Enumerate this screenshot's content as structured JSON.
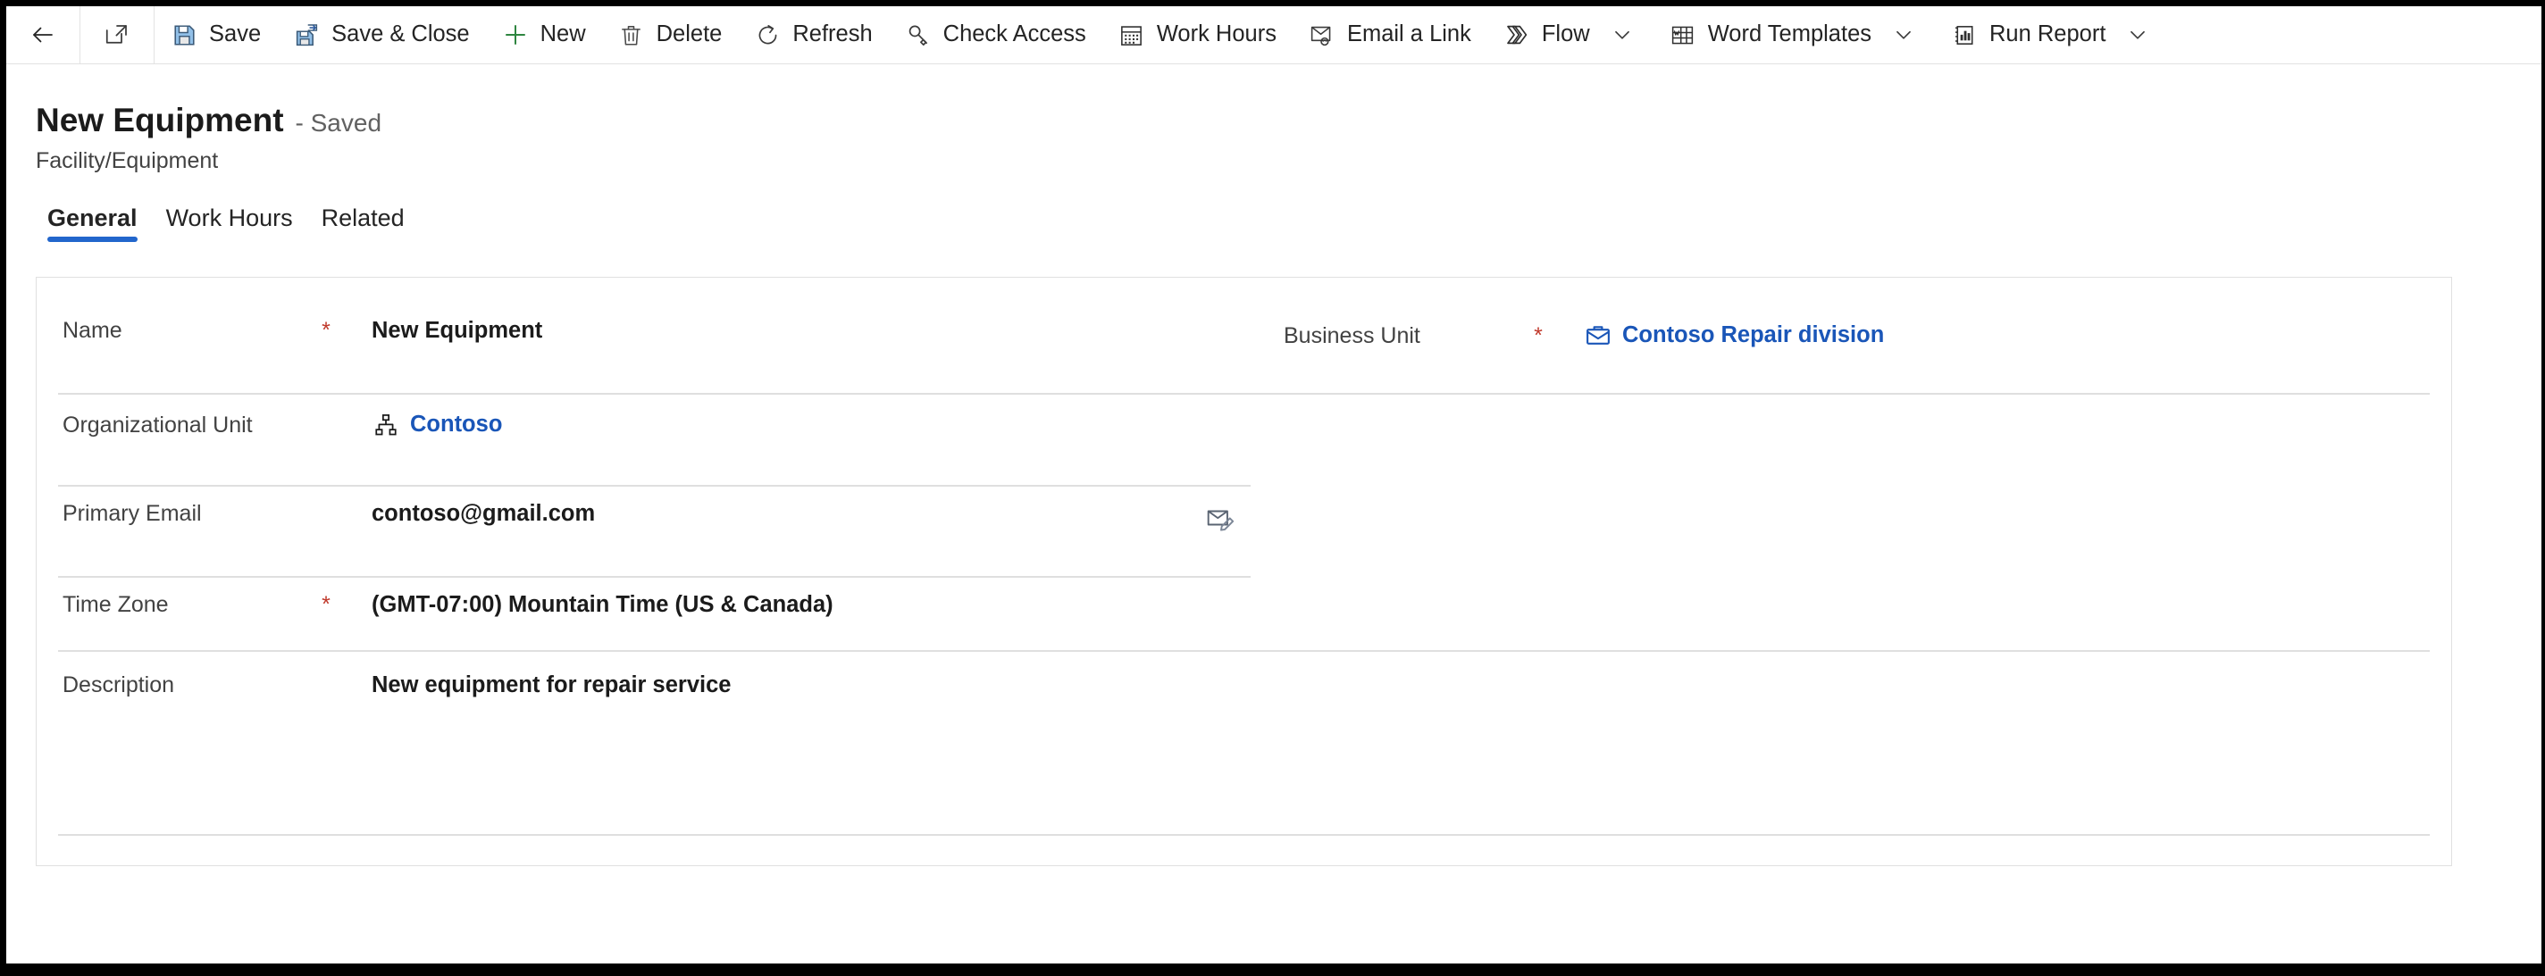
{
  "commandbar": {
    "buttons": [
      {
        "name": "back",
        "icon": "back-arrow-icon",
        "label": "",
        "caret": false
      },
      {
        "name": "popout",
        "icon": "open-in-new-window-icon",
        "label": "",
        "caret": false
      },
      {
        "name": "save",
        "icon": "save-icon",
        "label": "Save",
        "caret": false
      },
      {
        "name": "save-and-close",
        "icon": "save-and-close-icon",
        "label": "Save & Close",
        "caret": false
      },
      {
        "name": "new",
        "icon": "plus-icon",
        "label": "New",
        "caret": false
      },
      {
        "name": "delete",
        "icon": "trash-icon",
        "label": "Delete",
        "caret": false
      },
      {
        "name": "refresh",
        "icon": "refresh-icon",
        "label": "Refresh",
        "caret": false
      },
      {
        "name": "check-access",
        "icon": "key-icon",
        "label": "Check Access",
        "caret": false
      },
      {
        "name": "work-hours",
        "icon": "calendar-icon",
        "label": "Work Hours",
        "caret": false
      },
      {
        "name": "email-a-link",
        "icon": "email-link-icon",
        "label": "Email a Link",
        "caret": false
      },
      {
        "name": "flow",
        "icon": "flow-icon",
        "label": "Flow",
        "caret": true
      },
      {
        "name": "word-templates",
        "icon": "word-icon",
        "label": "Word Templates",
        "caret": true
      },
      {
        "name": "run-report",
        "icon": "report-chart-icon",
        "label": "Run Report",
        "caret": true
      }
    ]
  },
  "header": {
    "title": "New Equipment",
    "save_state": "- Saved",
    "entity_type": "Facility/Equipment"
  },
  "tabs": [
    {
      "label": "General",
      "active": true
    },
    {
      "label": "Work Hours",
      "active": false
    },
    {
      "label": "Related",
      "active": false
    }
  ],
  "form": {
    "fields": {
      "name": {
        "label": "Name",
        "required_marker": "*",
        "value": "New Equipment"
      },
      "business_unit": {
        "label": "Business Unit",
        "required_marker": "*",
        "value": "Contoso Repair division",
        "icon": "briefcase-icon",
        "is_link": true
      },
      "organizational_unit": {
        "label": "Organizational Unit",
        "required_marker": "",
        "value": "Contoso",
        "icon": "org-hierarchy-icon",
        "is_link": true
      },
      "primary_email": {
        "label": "Primary Email",
        "required_marker": "",
        "value": "contoso@gmail.com",
        "action_icon": "compose-email-icon"
      },
      "time_zone": {
        "label": "Time Zone",
        "required_marker": "*",
        "value": "(GMT-07:00) Mountain Time (US & Canada)"
      },
      "description": {
        "label": "Description",
        "required_marker": "",
        "value": "New equipment for repair service"
      }
    }
  },
  "colors": {
    "accent_blue": "#2266cc",
    "link_blue": "#1a56b8",
    "required_red": "#c0392b",
    "text_primary": "#1b1b1b",
    "text_secondary": "#616161",
    "divider": "#dfdfdf",
    "save_icon_blue": "#8cb8e0",
    "new_icon_green": "#2e8540"
  }
}
